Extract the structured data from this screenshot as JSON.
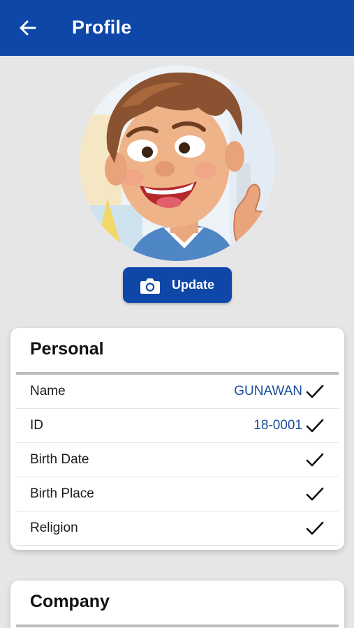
{
  "appbar": {
    "title": "Profile",
    "back_icon": "arrow-left-icon",
    "background": "#0e47a8"
  },
  "avatar": {
    "icon": "cartoon-boy-avatar"
  },
  "update_button": {
    "label": "Update",
    "icon": "camera-icon"
  },
  "personal": {
    "title": "Personal",
    "rows": [
      {
        "label": "Name",
        "value": "GUNAWAN",
        "icon": "check-icon"
      },
      {
        "label": "ID",
        "value": "18-0001",
        "icon": "check-icon"
      },
      {
        "label": "Birth Date",
        "value": "",
        "icon": "check-icon"
      },
      {
        "label": "Birth Place",
        "value": "",
        "icon": "check-icon"
      },
      {
        "label": "Religion",
        "value": "",
        "icon": "check-icon"
      }
    ]
  },
  "company": {
    "title": "Company"
  },
  "colors": {
    "accent": "#0e47a8",
    "value_text": "#1a4ea0",
    "background": "#e6e6e6"
  }
}
